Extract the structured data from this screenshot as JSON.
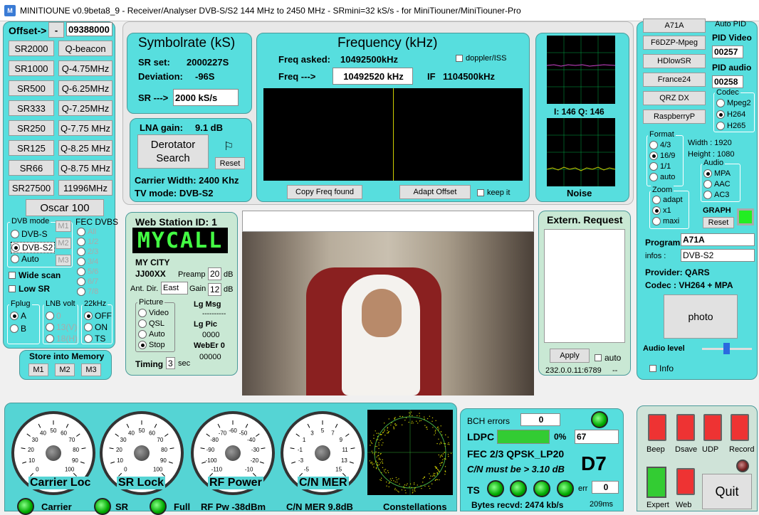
{
  "title": "MINITIOUNE v0.9beta8_9 - Receiver/Analyser DVB-S/S2 144 MHz to 2450 MHz - SRmini=32 kS/s - for MiniTiouner/MiniTiouner-Pro",
  "offset": {
    "label": "Offset->",
    "minus": "-",
    "value": "09388000"
  },
  "sr_buttons": [
    "SR2000",
    "SR1000",
    "SR500",
    "SR333",
    "SR250",
    "SR125",
    "SR66",
    "SR27500"
  ],
  "q_buttons": [
    "Q-beacon",
    "Q-4.75MHz",
    "Q-6.25MHz",
    "Q-7.25MHz",
    "Q-7.75 MHz",
    "Q-8.25 MHz",
    "Q-8.75 MHz",
    "11996MHz"
  ],
  "oscar": "Oscar 100",
  "dvb": {
    "mode_label": "DVB mode",
    "fec_label": "FEC DVBS",
    "modes": [
      "DVB-S",
      "DVB-S2",
      "Auto"
    ],
    "m1": "M1",
    "m2": "M2",
    "m3": "M3",
    "fec": [
      "All",
      "1/2",
      "2/3",
      "3/4",
      "5/6",
      "6/7",
      "7/8"
    ],
    "wide": "Wide scan",
    "low": "Low SR",
    "fplug": "Fplug",
    "fplug_opts": [
      "A",
      "B"
    ],
    "lnb": "LNB volt",
    "lnb_opts": [
      "0",
      "13(V)",
      "18(H)"
    ],
    "k22": "22kHz",
    "k22_opts": [
      "OFF",
      "ON",
      "TS"
    ]
  },
  "memory": {
    "label": "Store into Memory",
    "m1": "M1",
    "m2": "M2",
    "m3": "M3"
  },
  "symbolrate": {
    "title": "Symbolrate (kS)",
    "sr_set_label": "SR set:",
    "sr_set": "2000227S",
    "dev_label": "Deviation:",
    "dev": "-96S",
    "sr_label": "SR --->",
    "sr": "2000 kS/s"
  },
  "lna": {
    "label": "LNA gain:",
    "value": "9.1 dB",
    "derotator": "Derotator Search",
    "reset": "Reset",
    "carrier": "Carrier Width: 2400 Khz",
    "tvmode": "TV mode:  DVB-S2"
  },
  "frequency": {
    "title": "Frequency (kHz)",
    "asked_label": "Freq asked:",
    "asked": "10492500kHz",
    "doppler": "doppler/ISS",
    "freq_label": "Freq --->",
    "freq": "10492520 kHz",
    "if_label": "IF",
    "if": "1104500kHz",
    "copy": "Copy Freq found",
    "adapt": "Adapt Offset",
    "keep": "keep it"
  },
  "iq": {
    "label": "I:  146   Q:  146",
    "noise": "Noise"
  },
  "webstation": {
    "title": "Web Station ID:  1",
    "call": "MYCALL",
    "city": "MY CITY",
    "loc": "JJ00XX",
    "preamp_label": "Preamp",
    "preamp": "20",
    "db": "dB",
    "antdir_label": "Ant. Dir.",
    "antdir": "East",
    "gain_label": "Gain",
    "gain": "12",
    "picture": "Picture",
    "pic_opts": [
      "Video",
      "QSL",
      "Auto",
      "Stop"
    ],
    "lgmsg": "Lg Msg",
    "dashes": "----------",
    "lgpic": "Lg Pic",
    "lgpic_v": "0000",
    "weber": "WebEr 0",
    "weber_v": "00000",
    "timing": "Timing",
    "timing_v": "3",
    "sec": "sec"
  },
  "extern": {
    "title": "Extern. Request",
    "apply": "Apply",
    "auto": "auto",
    "ip": "232.0.0.11:6789",
    "dash": "--"
  },
  "right": {
    "presets": [
      "A71A",
      "F6DZP-Mpeg",
      "HDlowSR",
      "France24",
      "QRZ DX",
      "RaspberryP"
    ],
    "autopid": "Auto PID",
    "pidvideo_label": "PID Video",
    "pidvideo": "00257",
    "pidaudio_label": "PID audio",
    "pidaudio": "00258",
    "codec": "Codec",
    "codec_opts": [
      "Mpeg2",
      "H264",
      "H265"
    ],
    "format": "Format",
    "format_opts": [
      "4/3",
      "16/9",
      "1/1",
      "auto"
    ],
    "width": "Width :   1920",
    "height": "Height :  1080",
    "audio": "Audio",
    "audio_opts": [
      "MPA",
      "AAC",
      "AC3"
    ],
    "zoom": "Zoom",
    "zoom_opts": [
      "adapt",
      "x1",
      "maxi"
    ],
    "graph": "GRAPH",
    "graph_reset": "Reset",
    "program_label": "Program",
    "program": "A71A",
    "infos_label": "infos :",
    "infos": "DVB-S2",
    "provider": "Provider: QARS",
    "codec_line": "Codec :    VH264 + MPA",
    "photo": "photo",
    "audio_level": "Audio level",
    "info": "Info"
  },
  "gauges": [
    {
      "name": "Carrier Loc",
      "ticks": [
        "0",
        "10",
        "20",
        "30",
        "40",
        "50",
        "60",
        "70",
        "80",
        "90",
        "100"
      ]
    },
    {
      "name": "SR Lock",
      "ticks": [
        "0",
        "10",
        "20",
        "30",
        "40",
        "50",
        "60",
        "70",
        "80",
        "90",
        "100"
      ]
    },
    {
      "name": "RF Power",
      "ticks": [
        "-110",
        "-100",
        "-90",
        "-80",
        "-70",
        "-60",
        "-50",
        "-40",
        "-30",
        "-20",
        "-10"
      ]
    },
    {
      "name": "C/N MER",
      "ticks": [
        "-5",
        "-3",
        "-1",
        "1",
        "3",
        "5",
        "7",
        "9",
        "11",
        "13",
        "15"
      ]
    }
  ],
  "bottom_labels": {
    "carrier": "Carrier",
    "sr": "SR",
    "full": "Full",
    "rfpw": "RF Pw  -38dBm",
    "cnmer": "C/N MER  9.8dB",
    "const": "Constellations"
  },
  "status": {
    "bch": "BCH errors",
    "bch_v": "0",
    "ldpc": "LDPC",
    "ldpc_pct": "0%",
    "ldpc_v": "67",
    "fec": "FEC  2/3 QPSK_LP20",
    "cn": "C/N must be > 3.10 dB",
    "d7": "D7",
    "ts": "TS",
    "err": "err",
    "err_v": "0",
    "bytes": "Bytes recvd:  2474 kb/s",
    "ms": "209ms"
  },
  "switches": {
    "labels": [
      "Beep",
      "Dsave",
      "UDP",
      "Record"
    ],
    "expert": "Expert",
    "web": "Web",
    "quit": "Quit"
  }
}
